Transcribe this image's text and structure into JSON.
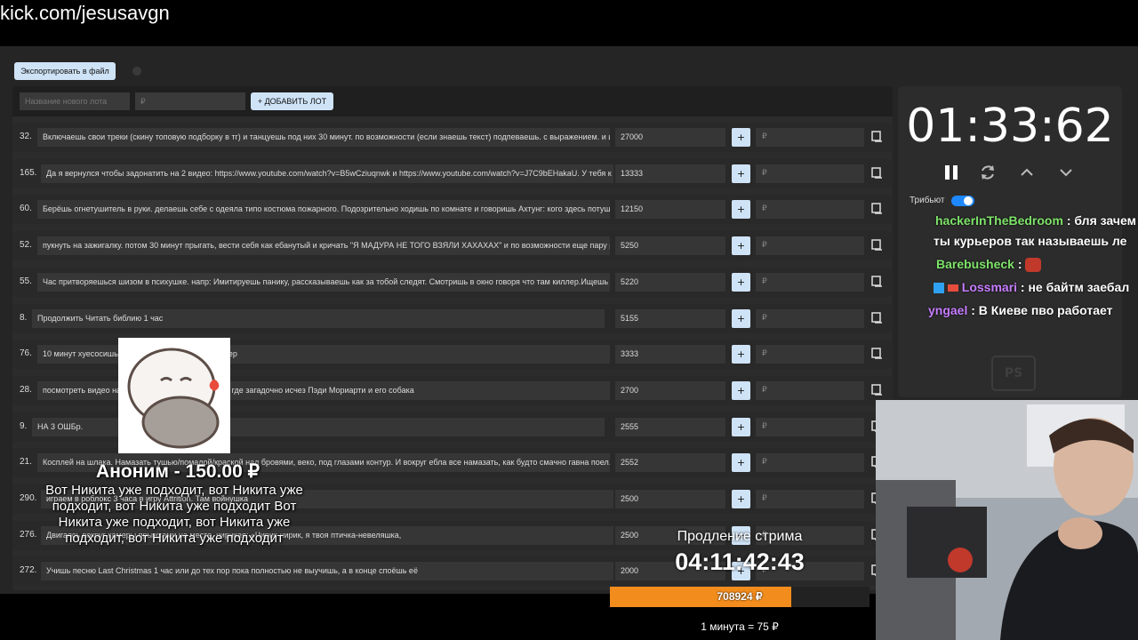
{
  "browser": {
    "url": "kick.com/jesusavgn"
  },
  "toolbar": {
    "export_label": "Экспортировать в файл"
  },
  "add_lot": {
    "name_placeholder": "Название нового лота",
    "amount_placeholder": "₽",
    "add_label": "+ ДОБАВИТЬ ЛОТ"
  },
  "lots": [
    {
      "num": "32.",
      "text": "Включаешь свои треки (скину топовую подборку в тг) и танцуешь под них 30 минут. по возможности (если знаешь текст) подпеваешь. с выражением. и и",
      "amount": "27000",
      "plus": "+",
      "rub": "₽"
    },
    {
      "num": "165.",
      "text": "Да я вернулся чтобы задонатить на 2 видео: https://www.youtube.com/watch?v=B5wCziuqnwk и https://www.youtube.com/watch?v=J7C9bEHakaU. У тебя к",
      "amount": "13333",
      "plus": "+",
      "rub": "₽"
    },
    {
      "num": "60.",
      "text": "Берёшь огнетушитель в руки. делаешь себе с одеяла типо костюма пожарного. Подозрительно ходишь по комнате и говоришь Ахтунг: кого здесь потуш",
      "amount": "12150",
      "plus": "+",
      "rub": "₽"
    },
    {
      "num": "52.",
      "text": "пукнуть на зажигалку. потом 30 минут прыгать, вести себя как ебанутый и кричать \"Я МАДУРА НЕ ТОГО ВЗЯЛИ ХАХАХАХ\" и по возможности еще пару р",
      "amount": "5250",
      "plus": "+",
      "rub": "₽"
    },
    {
      "num": "55.",
      "text": "Час притворяешься шизом в психушке. напр: Имитируешь панику, рассказываешь как за тобой следят. Смотришь в окно говоря что там киллер.Ищешь с",
      "amount": "5220",
      "plus": "+",
      "rub": "₽"
    },
    {
      "num": "8.",
      "text": "Продолжить Читать библию 1 час",
      "amount": "5155",
      "plus": "+",
      "rub": "₽"
    },
    {
      "num": "76.",
      "text": "10 минут хуесосишь                              с позором, несмотря на таймер",
      "amount": "3333",
      "plus": "+",
      "rub": "₽"
    },
    {
      "num": "28.",
      "text": "посмотреть видео на                              с населением из 11 человек, где загадочно исчез Пэди Мориарти и его собака",
      "amount": "2700",
      "plus": "+",
      "rub": "₽"
    },
    {
      "num": "9.",
      "text": "НА 3 ОШБр.",
      "amount": "2555",
      "plus": "+",
      "rub": "₽"
    },
    {
      "num": "21.",
      "text": "Косплей на шлака. Намазать тушью/помадой/краской над бровями, веко, под глазами контур. И вокруг ебла все намазать, как будто смачно гавна поел.",
      "amount": "2552",
      "plus": "+",
      "rub": "₽"
    },
    {
      "num": "290.",
      "text": "играем в роблокс 3 часа в игру Attrition. Там войнушка",
      "amount": "2500",
      "plus": "+",
      "rub": "₽"
    },
    {
      "num": "276.",
      "text": "Двигаясь вокруг камеры прыжками на месте, чирикая: «Чирик-чирик, я твоя птичка-невеляшка, ",
      "amount": "2500",
      "plus": "+",
      "rub": "₽"
    },
    {
      "num": "272.",
      "text": "Учишь песню Last Christmas 1 час или до тех пор пока полностью не выучишь, а в конце споёшь её",
      "amount": "2000",
      "plus": "+",
      "rub": "₽"
    }
  ],
  "timer": {
    "value": "01:33:62",
    "tribute_label": "Трибьют"
  },
  "chat": [
    {
      "user": "hackerInTheBedroom",
      "color": "#7ee36a",
      "text": ": бля зачем"
    },
    {
      "user": "",
      "color": "#ffffff",
      "text": "ты курьеров так называешь ле"
    },
    {
      "user": "Barebusheck",
      "color": "#7ee36a",
      "text": ":"
    },
    {
      "user": "Lossmari",
      "color": "#c77dff",
      "text": ": не байтм заебал"
    },
    {
      "user": "yngael",
      "color": "#c77dff",
      "text": ": В Киеве пво работает"
    }
  ],
  "ps_label": "PS",
  "alert": {
    "title": "Аноним - 150.00 ₽",
    "message": "Вот Никита уже подходит, вот Никита уже подходит, вот Никита уже подходит Вот Никита уже подходит, вот Никита уже подходит, вот Никита уже подходит"
  },
  "extension": {
    "label": "Продление стрима",
    "timer": "04:11:42:43",
    "amount_label": "708924 ₽",
    "progress_fraction": 0.7,
    "rate": "1 минута = 75 ₽"
  },
  "colors": {
    "accent": "#cfe3f7",
    "toggle": "#1e88ff",
    "progress": "#f28c1d",
    "panel": "#2c2c2c"
  }
}
